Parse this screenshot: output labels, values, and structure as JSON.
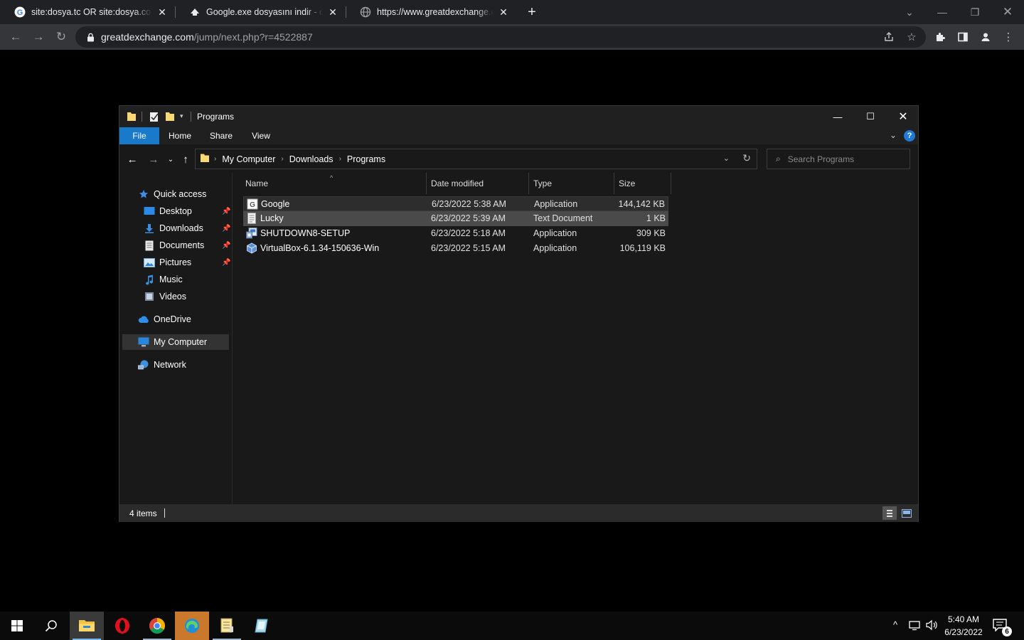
{
  "browser": {
    "tabs": [
      {
        "title": "site:dosya.tc OR site:dosya.co exe",
        "icon": "google-icon"
      },
      {
        "title": "Google.exe dosyasını indir - dow",
        "icon": "download-site-icon"
      },
      {
        "title": "https://www.greatdexchange.com",
        "icon": "globe-icon"
      }
    ],
    "url_host": "greatdexchange.com",
    "url_path": "/jump/next.php?r=4522887"
  },
  "explorer": {
    "title": "Programs",
    "ribbon_tabs": [
      "File",
      "Home",
      "Share",
      "View"
    ],
    "breadcrumbs": [
      "My Computer",
      "Downloads",
      "Programs"
    ],
    "search_placeholder": "Search Programs",
    "nav": {
      "quick_access": "Quick access",
      "desktop": "Desktop",
      "downloads": "Downloads",
      "documents": "Documents",
      "pictures": "Pictures",
      "music": "Music",
      "videos": "Videos",
      "onedrive": "OneDrive",
      "my_computer": "My Computer",
      "network": "Network"
    },
    "columns": {
      "name": "Name",
      "date": "Date modified",
      "type": "Type",
      "size": "Size"
    },
    "files": [
      {
        "name": "Google",
        "date": "6/23/2022 5:38 AM",
        "type": "Application",
        "size": "144,142 KB",
        "icon": "google-app-icon"
      },
      {
        "name": "Lucky",
        "date": "6/23/2022 5:39 AM",
        "type": "Text Document",
        "size": "1 KB",
        "icon": "text-document-icon"
      },
      {
        "name": "SHUTDOWN8-SETUP",
        "date": "6/23/2022 5:18 AM",
        "type": "Application",
        "size": "309 KB",
        "icon": "setup-app-icon"
      },
      {
        "name": "VirtualBox-6.1.34-150636-Win",
        "date": "6/23/2022 5:15 AM",
        "type": "Application",
        "size": "106,119 KB",
        "icon": "virtualbox-icon"
      }
    ],
    "status": "4 items"
  },
  "taskbar": {
    "time": "5:40 AM",
    "date": "6/23/2022",
    "notifications": "6"
  }
}
